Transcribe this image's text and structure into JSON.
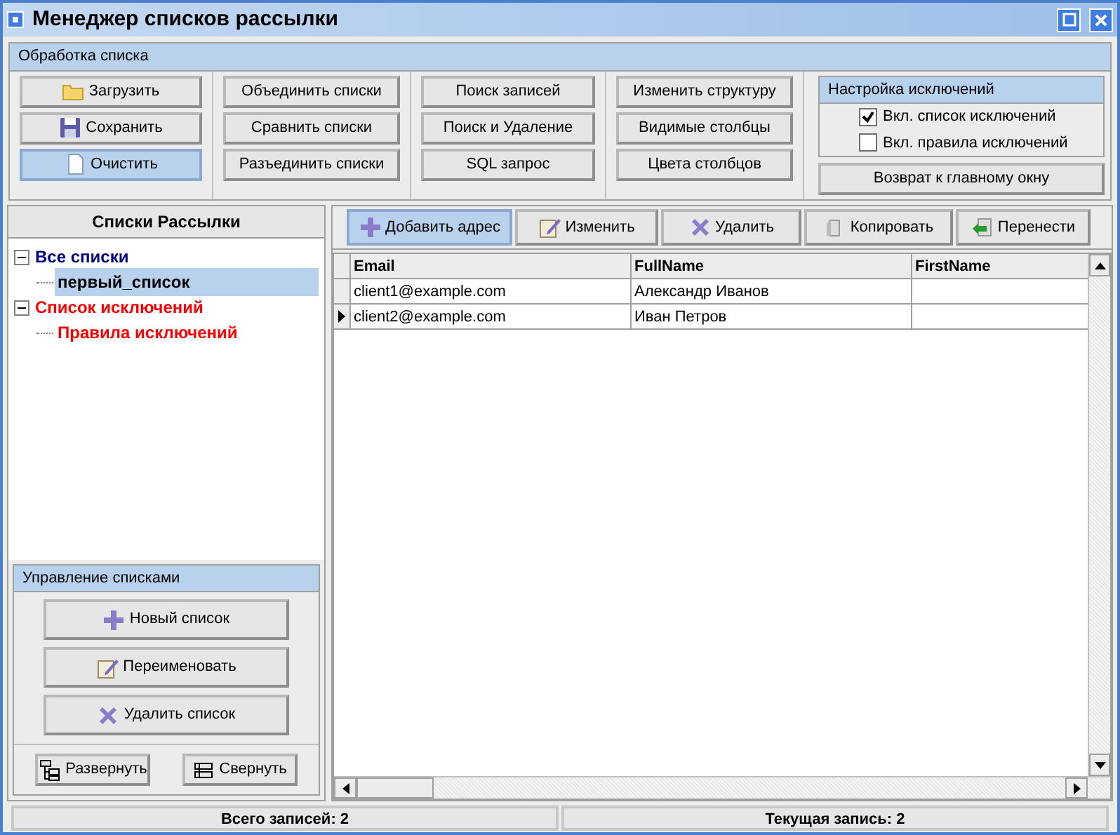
{
  "window": {
    "title": "Менеджер списков рассылки"
  },
  "processing": {
    "title": "Обработка списка",
    "button_columns": [
      [
        {
          "label": "Загрузить",
          "kind": "folder",
          "selected": false
        },
        {
          "label": "Сохранить",
          "kind": "floppy",
          "selected": false
        },
        {
          "label": "Очистить",
          "kind": "page",
          "selected": true
        }
      ],
      [
        {
          "label": "Объединить списки",
          "selected": false
        },
        {
          "label": "Сравнить списки",
          "selected": false
        },
        {
          "label": "Разъединить списки",
          "selected": false
        }
      ],
      [
        {
          "label": "Поиск записей",
          "selected": false
        },
        {
          "label": "Поиск и Удаление",
          "selected": false
        },
        {
          "label": "SQL запрос",
          "selected": false
        }
      ],
      [
        {
          "label": "Изменить структуру",
          "selected": false
        },
        {
          "label": "Видимые столбцы",
          "selected": false
        },
        {
          "label": "Цвета столбцов",
          "selected": false
        }
      ]
    ]
  },
  "exclusions": {
    "title": "Настройка исключений",
    "options": [
      {
        "label": "Вкл. список исключений",
        "checked": true
      },
      {
        "label": "Вкл. правила исключений",
        "checked": false
      }
    ],
    "button": "Возврат к главному окну"
  },
  "lists_panel": {
    "title": "Списки Рассылки",
    "tree": [
      {
        "label": "Все списки",
        "color": "#000080",
        "expanded": true,
        "selected": false,
        "children": [
          {
            "label": "первый_список",
            "color": "#000000",
            "selected": true
          }
        ]
      },
      {
        "label": "Список исключений",
        "color": "#ff0000",
        "expanded": true,
        "selected": false,
        "children": [
          {
            "label": "Правила исключений",
            "color": "#ff0000",
            "selected": false
          }
        ]
      }
    ]
  },
  "management": {
    "title": "Управление списками",
    "buttons": [
      {
        "label": "Новый список",
        "kind": "plus"
      },
      {
        "label": "Переименовать",
        "kind": "note"
      },
      {
        "label": "Удалить список",
        "kind": "cross"
      }
    ],
    "tree_buttons": [
      {
        "label": "Развернуть",
        "kind": "expand"
      },
      {
        "label": "Свернуть",
        "kind": "collapse"
      }
    ]
  },
  "toolbar": [
    {
      "label": "Добавить адрес",
      "kind": "plus",
      "selected": true
    },
    {
      "label": "Изменить",
      "kind": "note",
      "selected": false
    },
    {
      "label": "Удалить",
      "kind": "cross",
      "selected": false
    },
    {
      "label": "Копировать",
      "kind": "copy",
      "selected": false
    },
    {
      "label": "Перенести",
      "kind": "move",
      "selected": false
    }
  ],
  "grid": {
    "columns": [
      "Email",
      "FullName",
      "FirstName"
    ],
    "rows": [
      {
        "cells": [
          "client1@example.com",
          "Александр Иванов",
          ""
        ],
        "current": false
      },
      {
        "cells": [
          "client2@example.com",
          "Иван Петров",
          ""
        ],
        "current": true
      }
    ]
  },
  "status_bar": [
    "Всего записей: 2",
    "Текущая запись: 2"
  ]
}
